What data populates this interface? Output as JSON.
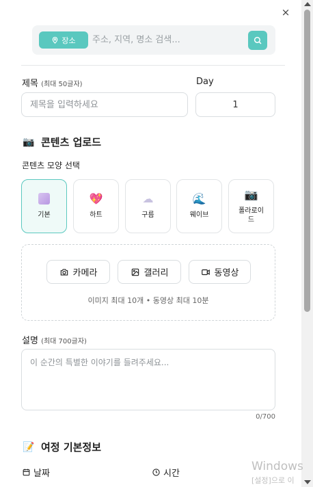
{
  "close_label": "×",
  "search": {
    "location_chip": "장소",
    "placeholder": "주소, 지역, 명소 검색..."
  },
  "title_field": {
    "label": "제목",
    "hint": "(최대 50글자)",
    "placeholder": "제목을 입력하세요"
  },
  "day_field": {
    "label": "Day",
    "value": "1"
  },
  "content_upload": {
    "title": "콘텐츠 업로드",
    "emoji": "📷",
    "shape_label": "콘텐츠 모양 선택",
    "shapes": [
      {
        "label": "기본",
        "icon": "square-icon",
        "glyph": "",
        "selected": true
      },
      {
        "label": "하트",
        "icon": "heart-icon",
        "glyph": "💖",
        "selected": false
      },
      {
        "label": "구름",
        "icon": "cloud-icon",
        "glyph": "☁",
        "selected": false
      },
      {
        "label": "웨이브",
        "icon": "wave-icon",
        "glyph": "🌊",
        "selected": false
      },
      {
        "label": "폴라로이\n드",
        "icon": "camera-icon",
        "glyph": "📷",
        "selected": false
      }
    ],
    "buttons": {
      "camera": "카메라",
      "gallery": "갤러리",
      "video": "동영상"
    },
    "hint": "이미지 최대 10개 • 동영상 최대 10분"
  },
  "description": {
    "label": "설명",
    "hint": "(최대 700글자)",
    "placeholder": "이 순간의 특별한 이야기를 들려주세요...",
    "counter": "0/700"
  },
  "trip_info": {
    "title": "여정 기본정보",
    "emoji": "📝",
    "date_label": "날짜",
    "time_label": "시간"
  },
  "watermark": {
    "line1": "Windows",
    "line2": "[설정]으로 이"
  },
  "colors": {
    "accent": "#5ac8bf"
  }
}
